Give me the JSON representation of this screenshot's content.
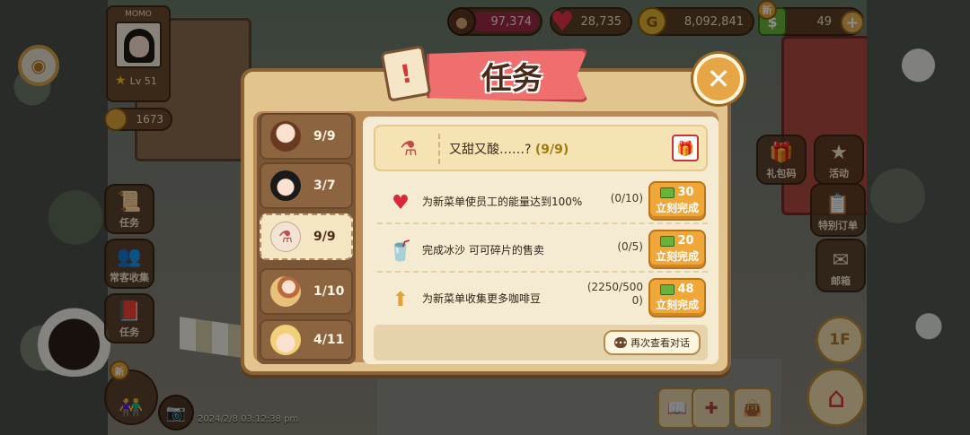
{
  "hud": {
    "profile_name": "MOMO",
    "level": "Lv 51",
    "medals": "1673",
    "coffee_beans": "97,374",
    "hearts": "28,735",
    "gold": "8,092,841",
    "cash": "49",
    "new_badge": "新",
    "timestamp": "2024/2/8 03:12:38 pm",
    "floor": "1F",
    "colors": {
      "accent": "#f0a73a",
      "heart": "#e8304a",
      "title_banner": "#ef6f6f"
    }
  },
  "left_buttons": {
    "task_label": "任务",
    "regular_label": "常客收集",
    "mission_label": "任务",
    "new_badge": "新"
  },
  "right_buttons": {
    "gift_label": "礼包码",
    "event_label": "活动",
    "special_label": "特别订单",
    "mail_label": "邮箱"
  },
  "dialog": {
    "title": "任务",
    "close_icon": "close-icon",
    "tabs": [
      {
        "progress": "9/9",
        "portrait": "couple-portrait"
      },
      {
        "progress": "3/7",
        "portrait": "dark-hair-portrait"
      },
      {
        "progress": "9/9",
        "portrait": "drink-icon"
      },
      {
        "progress": "1/10",
        "portrait": "redhead-portrait"
      },
      {
        "progress": "4/11",
        "portrait": "blonde-portrait"
      }
    ],
    "quest": {
      "title": "又甜又酸……?",
      "progress": "(9/9)"
    },
    "tasks": [
      {
        "name": "为新菜单使员工的能量达到100%",
        "progress": "(0/10)",
        "cost": "30",
        "button": "立刻完成",
        "icon_text": "100%"
      },
      {
        "name": "完成冰沙 可可碎片的售卖",
        "progress": "(0/5)",
        "cost": "20",
        "button": "立刻完成",
        "icon_text": ""
      },
      {
        "name": "为新菜单收集更多咖啡豆",
        "progress": "(2250/5000)",
        "cost": "48",
        "button": "立刻完成",
        "icon_text": ""
      }
    ],
    "review_button": "再次查看对话"
  }
}
